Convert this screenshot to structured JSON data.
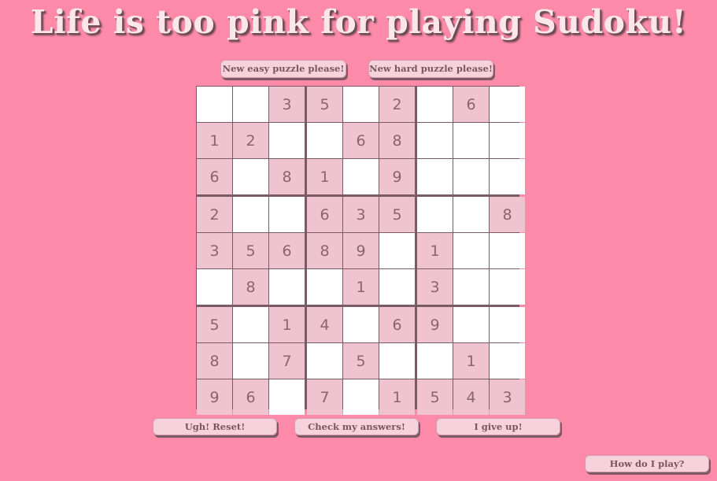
{
  "title": "Life is too pink for playing Sudoku!",
  "buttons": {
    "new_easy": "New easy puzzle please!",
    "new_hard": "New hard puzzle please!",
    "reset": "Ugh! Reset!",
    "check": "Check my answers!",
    "give_up": "I give up!",
    "help": "How do I play?"
  },
  "colors": {
    "background": "#fc8aa8",
    "given_cell": "#efc3d0",
    "empty_cell": "#ffffff",
    "grid_lines": "#7a5a64",
    "digit_text": "#8a6470"
  },
  "grid": [
    [
      "",
      "",
      "3",
      "5",
      "",
      "2",
      "",
      "6",
      ""
    ],
    [
      "1",
      "2",
      "",
      "",
      "6",
      "8",
      "",
      "",
      ""
    ],
    [
      "6",
      "",
      "8",
      "1",
      "",
      "9",
      "",
      "",
      ""
    ],
    [
      "2",
      "",
      "",
      "6",
      "3",
      "5",
      "",
      "",
      "8"
    ],
    [
      "3",
      "5",
      "6",
      "8",
      "9",
      "",
      "1",
      "",
      ""
    ],
    [
      "",
      "8",
      "",
      "",
      "1",
      "",
      "3",
      "",
      ""
    ],
    [
      "5",
      "",
      "1",
      "4",
      "",
      "6",
      "9",
      "",
      ""
    ],
    [
      "8",
      "",
      "7",
      "",
      "5",
      "",
      "",
      "1",
      ""
    ],
    [
      "9",
      "6",
      "",
      "7",
      "",
      "1",
      "5",
      "4",
      "3"
    ]
  ]
}
